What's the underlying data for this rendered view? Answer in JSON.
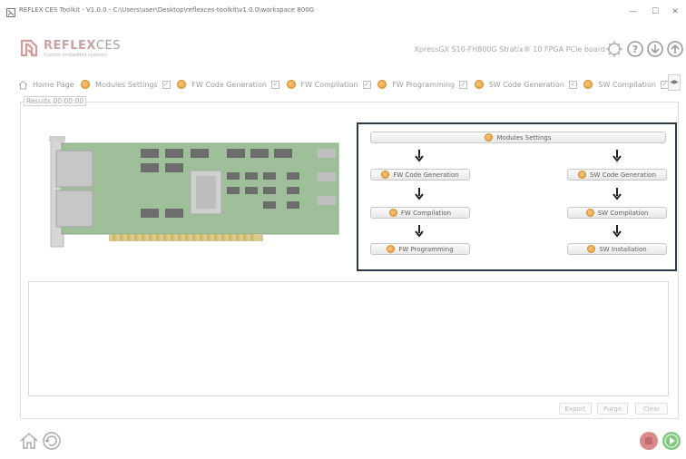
{
  "window": {
    "title": "REFLEX CES Toolkit - V1.0.0 - C:\\Users\\user\\Desktop\\reflexces-toolkit\\v1.0.0\\workspace 800G",
    "minimize": "—",
    "maximize": "☐",
    "close": "✕"
  },
  "header": {
    "brand_part1": "REFLEX",
    "brand_part2": "CES",
    "tagline": "Custom embedded systems",
    "board_name": "XpressGX S10-FH800G Stratix® 10 FPGA PCIe board",
    "icons": [
      "board-icon",
      "help-icon",
      "download-icon",
      "upload-icon"
    ]
  },
  "tabs": [
    {
      "label": "Home Page",
      "icon": "home-icon",
      "checked": false
    },
    {
      "label": "Modules Settings",
      "icon": "status-dot",
      "checked": true
    },
    {
      "label": "FW Code Generation",
      "icon": "status-dot",
      "checked": true
    },
    {
      "label": "FW Compilation",
      "icon": "status-dot",
      "checked": true
    },
    {
      "label": "FW Programming",
      "icon": "status-dot",
      "checked": true
    },
    {
      "label": "SW Code Generation",
      "icon": "status-dot",
      "checked": true
    },
    {
      "label": "SW Compilation",
      "icon": "status-dot",
      "checked": true
    }
  ],
  "check_mark": "✓",
  "tab_scroll": "◀▶",
  "results": {
    "label": "Results 00:00:00"
  },
  "flow": {
    "modules_settings": "Modules Settings",
    "fw_code_generation": "FW Code Generation",
    "fw_compilation": "FW Compilation",
    "fw_programming": "FW Programming",
    "sw_code_generation": "SW Code Generation",
    "sw_compilation": "SW Compilation",
    "sw_installation": "SW Installation"
  },
  "actions": {
    "export": "Export",
    "purge": "Purge",
    "clear": "Clear"
  },
  "colors": {
    "status_dot": "#e59a3a",
    "flow_border": "#2b3a4a",
    "stop": "#d98a8a",
    "run": "#7fc97f"
  }
}
